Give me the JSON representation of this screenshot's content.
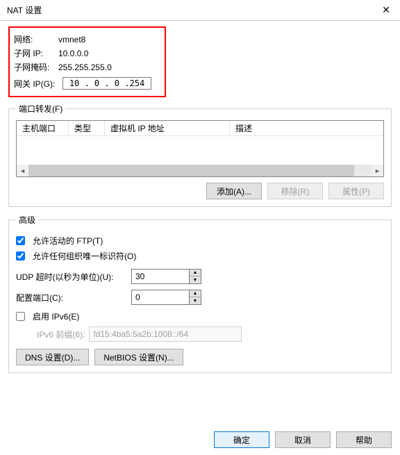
{
  "window": {
    "title": "NAT 设置"
  },
  "network": {
    "network_label": "网络:",
    "network_value": "vmnet8",
    "subnet_ip_label": "子网 IP:",
    "subnet_ip_value": "10.0.0.0",
    "subnet_mask_label": "子网掩码:",
    "subnet_mask_value": "255.255.255.0",
    "gateway_label": "网关 IP(G):",
    "gateway_value": "10 . 0 . 0 .254"
  },
  "portfwd": {
    "legend": "端口转发(F)",
    "headers": {
      "host_port": "主机端口",
      "type": "类型",
      "vm_ip": "虚拟机 IP 地址",
      "desc": "描述"
    },
    "add": "添加(A)...",
    "remove": "移除(R)",
    "props": "属性(P)"
  },
  "advanced": {
    "legend": "高级",
    "ftp_label": "允许活动的 FTP(T)",
    "oui_label": "允许任何组织唯一标识符(O)",
    "udp_label": "UDP 超时(以秒为单位)(U):",
    "udp_value": "30",
    "cfg_port_label": "配置端口(C):",
    "cfg_port_value": "0",
    "ipv6_enable_label": "启用 IPv6(E)",
    "ipv6_prefix_label": "IPv6 前缀(6):",
    "ipv6_prefix_value": "fd15:4ba5:5a2b:1008::/64",
    "dns_btn": "DNS 设置(D)...",
    "netbios_btn": "NetBIOS 设置(N)..."
  },
  "footer": {
    "ok": "确定",
    "cancel": "取消",
    "help": "帮助"
  }
}
